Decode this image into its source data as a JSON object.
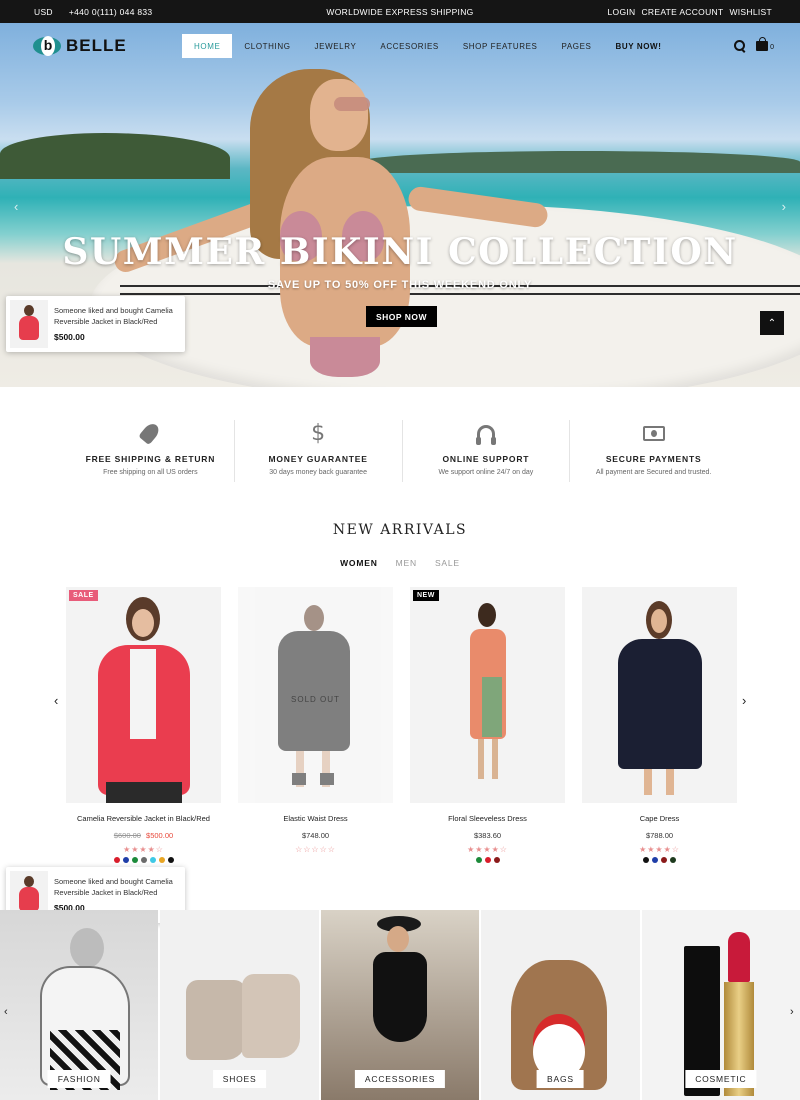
{
  "topbar": {
    "currency": "USD",
    "phone": "+440 0(111) 044 833",
    "shipping": "WORLDWIDE EXPRESS SHIPPING",
    "login": "LOGIN",
    "create_account": "CREATE ACCOUNT",
    "wishlist": "WISHLIST"
  },
  "header": {
    "logo_text": "BELLE",
    "nav": [
      "HOME",
      "CLOTHING",
      "JEWELRY",
      "ACCESORIES",
      "SHOP FEATURES",
      "PAGES",
      "BUY NOW!"
    ],
    "cart_count": "0"
  },
  "hero": {
    "title": "SUMMER BIKINI COLLECTION",
    "subtitle": "SAVE UP TO 50% OFF THIS WEEKEND ONLY",
    "button": "SHOP NOW"
  },
  "popup": {
    "message": "Someone liked and bought Camelia Reversible Jacket in Black/Red",
    "price": "$500.00"
  },
  "features": [
    {
      "icon": "rocket-icon",
      "title": "FREE SHIPPING & RETURN",
      "subtitle": "Free shipping on all US orders"
    },
    {
      "icon": "dollar-icon",
      "title": "MONEY GUARANTEE",
      "subtitle": "30 days money back guarantee"
    },
    {
      "icon": "headset-icon",
      "title": "ONLINE SUPPORT",
      "subtitle": "We support online 24/7 on day"
    },
    {
      "icon": "money-icon",
      "title": "SECURE PAYMENTS",
      "subtitle": "All payment are Secured and trusted."
    }
  ],
  "new_arrivals": {
    "title": "NEW ARRIVALS",
    "tabs": [
      "WOMEN",
      "MEN",
      "SALE"
    ],
    "products": [
      {
        "name": "Camelia Reversible Jacket in Black/Red",
        "old_price": "$600.00",
        "price": "$500.00",
        "badge": "SALE",
        "stars": "★★★★☆",
        "swatches": [
          "#d91d2b",
          "#1f3ea8",
          "#1c8a3a",
          "#6b6b6b",
          "#3fc9e6",
          "#e8a523",
          "#111111"
        ]
      },
      {
        "name": "Elastic Waist Dress",
        "price": "$748.00",
        "sold_out": "SOLD OUT",
        "stars": "☆☆☆☆☆",
        "swatches": []
      },
      {
        "name": "Floral Sleeveless Dress",
        "price": "$383.60",
        "badge": "NEW",
        "stars": "★★★★☆",
        "swatches": [
          "#1c8a3a",
          "#d91d2b",
          "#8b1a1a"
        ]
      },
      {
        "name": "Cape Dress",
        "price": "$788.00",
        "stars": "★★★★☆",
        "swatches": [
          "#111111",
          "#1f3ea8",
          "#8b1a1a",
          "#1e3a1e"
        ]
      }
    ]
  },
  "categories": [
    "FASHION",
    "SHOES",
    "ACCESSORIES",
    "BAGS",
    "COSMETIC"
  ],
  "colors": {
    "accent": "#2a9b9b",
    "sale_badge": "#e85c7a",
    "price_red": "#e8493b",
    "topbar_bg": "#151515"
  }
}
